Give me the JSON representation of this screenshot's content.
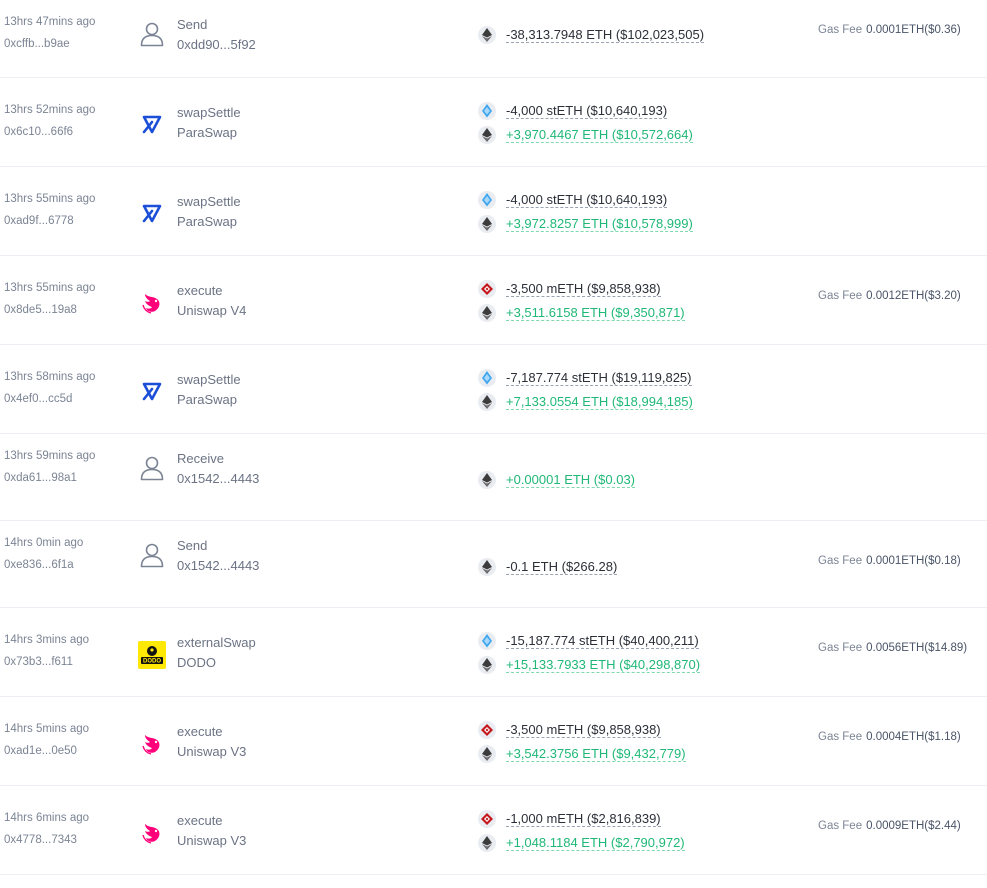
{
  "gas_label": "Gas Fee",
  "colors": {
    "positive": "#1fb877",
    "negative": "#2b2f38",
    "paraswap": "#1c4fd7",
    "uniswap": "#ff007a",
    "dodo": "#ffe804",
    "steth": "#3fa6ee",
    "meth": "#c4161c"
  },
  "rows": [
    {
      "time": "13hrs 47mins ago",
      "hash": "0xcffb...b9ae",
      "icon": "user-icon",
      "action": "Send",
      "party": "0xdd90...5f92",
      "assets": [
        {
          "token": "eth-icon",
          "amount": "-38,313.7948 ETH ($102,023,505)",
          "sign": "neg"
        }
      ],
      "gas": "0.0001ETH($0.36)"
    },
    {
      "time": "13hrs 52mins ago",
      "hash": "0x6c10...66f6",
      "icon": "paraswap-icon",
      "action": "swapSettle",
      "party": "ParaSwap",
      "assets": [
        {
          "token": "steth-icon",
          "amount": "-4,000 stETH ($10,640,193)",
          "sign": "neg"
        },
        {
          "token": "eth-icon",
          "amount": "+3,970.4467 ETH ($10,572,664)",
          "sign": "pos"
        }
      ],
      "gas": ""
    },
    {
      "time": "13hrs 55mins ago",
      "hash": "0xad9f...6778",
      "icon": "paraswap-icon",
      "action": "swapSettle",
      "party": "ParaSwap",
      "assets": [
        {
          "token": "steth-icon",
          "amount": "-4,000 stETH ($10,640,193)",
          "sign": "neg"
        },
        {
          "token": "eth-icon",
          "amount": "+3,972.8257 ETH ($10,578,999)",
          "sign": "pos"
        }
      ],
      "gas": ""
    },
    {
      "time": "13hrs 55mins ago",
      "hash": "0x8de5...19a8",
      "icon": "uniswap-icon",
      "action": "execute",
      "party": "Uniswap V4",
      "assets": [
        {
          "token": "meth-icon",
          "amount": "-3,500 mETH ($9,858,938)",
          "sign": "neg"
        },
        {
          "token": "eth-icon",
          "amount": "+3,511.6158 ETH ($9,350,871)",
          "sign": "pos"
        }
      ],
      "gas": "0.0012ETH($3.20)"
    },
    {
      "time": "13hrs 58mins ago",
      "hash": "0x4ef0...cc5d",
      "icon": "paraswap-icon",
      "action": "swapSettle",
      "party": "ParaSwap",
      "assets": [
        {
          "token": "steth-icon",
          "amount": "-7,187.774 stETH ($19,119,825)",
          "sign": "neg"
        },
        {
          "token": "eth-icon",
          "amount": "+7,133.0554 ETH ($18,994,185)",
          "sign": "pos"
        }
      ],
      "gas": ""
    },
    {
      "time": "13hrs 59mins ago",
      "hash": "0xda61...98a1",
      "icon": "user-icon",
      "action": "Receive",
      "party": "0x1542...4443",
      "assets": [
        {
          "token": "eth-icon",
          "amount": "+0.00001 ETH ($0.03)",
          "sign": "pos"
        }
      ],
      "gas": ""
    },
    {
      "time": "14hrs 0min ago",
      "hash": "0xe836...6f1a",
      "icon": "user-icon",
      "action": "Send",
      "party": "0x1542...4443",
      "assets": [
        {
          "token": "eth-icon",
          "amount": "-0.1 ETH ($266.28)",
          "sign": "neg"
        }
      ],
      "gas": "0.0001ETH($0.18)"
    },
    {
      "time": "14hrs 3mins ago",
      "hash": "0x73b3...f611",
      "icon": "dodo-icon",
      "action": "externalSwap",
      "party": "DODO",
      "assets": [
        {
          "token": "steth-icon",
          "amount": "-15,187.774 stETH ($40,400,211)",
          "sign": "neg"
        },
        {
          "token": "eth-icon",
          "amount": "+15,133.7933 ETH ($40,298,870)",
          "sign": "pos"
        }
      ],
      "gas": "0.0056ETH($14.89)"
    },
    {
      "time": "14hrs 5mins ago",
      "hash": "0xad1e...0e50",
      "icon": "uniswap-icon",
      "action": "execute",
      "party": "Uniswap V3",
      "assets": [
        {
          "token": "meth-icon",
          "amount": "-3,500 mETH ($9,858,938)",
          "sign": "neg"
        },
        {
          "token": "eth-icon",
          "amount": "+3,542.3756 ETH ($9,432,779)",
          "sign": "pos"
        }
      ],
      "gas": "0.0004ETH($1.18)"
    },
    {
      "time": "14hrs 6mins ago",
      "hash": "0x4778...7343",
      "icon": "uniswap-icon",
      "action": "execute",
      "party": "Uniswap V3",
      "assets": [
        {
          "token": "meth-icon",
          "amount": "-1,000 mETH ($2,816,839)",
          "sign": "neg"
        },
        {
          "token": "eth-icon",
          "amount": "+1,048.1184 ETH ($2,790,972)",
          "sign": "pos"
        }
      ],
      "gas": "0.0009ETH($2.44)"
    }
  ]
}
